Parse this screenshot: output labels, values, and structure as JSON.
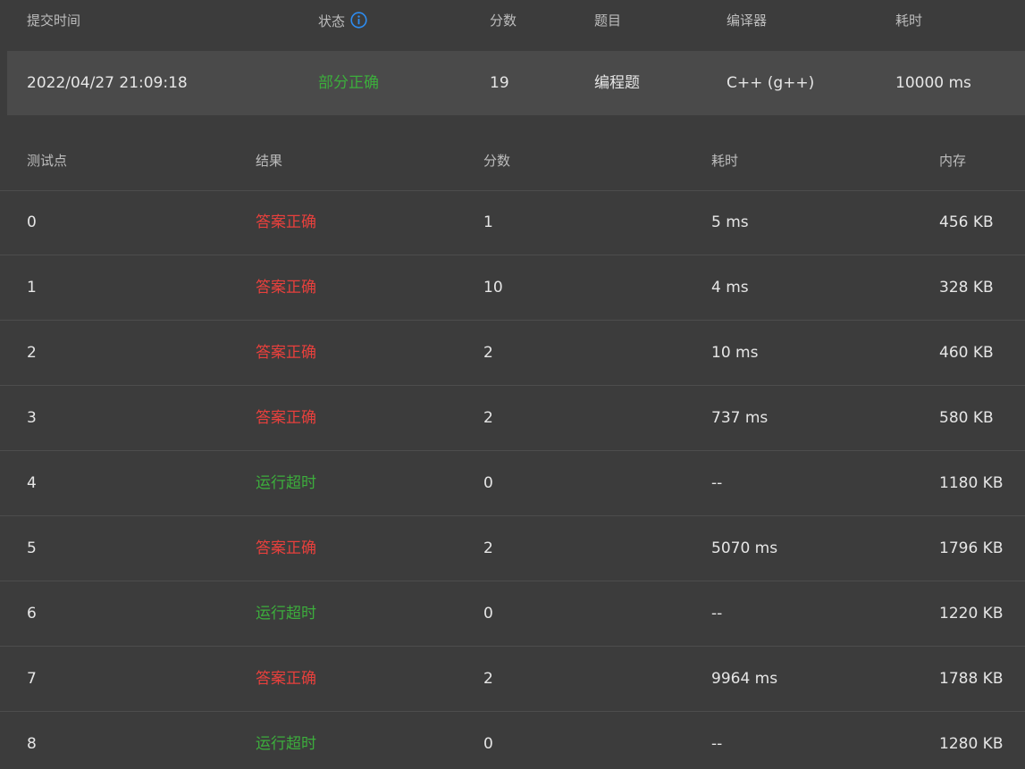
{
  "summary": {
    "headers": {
      "submit_time": "提交时间",
      "status": "状态",
      "score": "分数",
      "problem": "题目",
      "compiler": "编译器",
      "time": "耗时"
    },
    "row": {
      "submit_time": "2022/04/27 21:09:18",
      "status": "部分正确",
      "score": "19",
      "problem": "编程题",
      "compiler": "C++ (g++)",
      "time": "10000 ms"
    },
    "status_color": "#3cae3c",
    "info_icon": "info-circle-icon",
    "info_icon_color": "#2d8cf0"
  },
  "testcases": {
    "headers": {
      "case": "测试点",
      "result": "结果",
      "score": "分数",
      "time": "耗时",
      "memory": "内存"
    },
    "colors": {
      "accepted": "#e8403c",
      "time_limit": "#3cae3c"
    },
    "rows": [
      {
        "case": "0",
        "result": "答案正确",
        "kind": "ac",
        "score": "1",
        "time": "5 ms",
        "memory": "456 KB"
      },
      {
        "case": "1",
        "result": "答案正确",
        "kind": "ac",
        "score": "10",
        "time": "4 ms",
        "memory": "328 KB"
      },
      {
        "case": "2",
        "result": "答案正确",
        "kind": "ac",
        "score": "2",
        "time": "10 ms",
        "memory": "460 KB"
      },
      {
        "case": "3",
        "result": "答案正确",
        "kind": "ac",
        "score": "2",
        "time": "737 ms",
        "memory": "580 KB"
      },
      {
        "case": "4",
        "result": "运行超时",
        "kind": "tle",
        "score": "0",
        "time": "--",
        "memory": "1180 KB"
      },
      {
        "case": "5",
        "result": "答案正确",
        "kind": "ac",
        "score": "2",
        "time": "5070 ms",
        "memory": "1796 KB"
      },
      {
        "case": "6",
        "result": "运行超时",
        "kind": "tle",
        "score": "0",
        "time": "--",
        "memory": "1220 KB"
      },
      {
        "case": "7",
        "result": "答案正确",
        "kind": "ac",
        "score": "2",
        "time": "9964 ms",
        "memory": "1788 KB"
      },
      {
        "case": "8",
        "result": "运行超时",
        "kind": "tle",
        "score": "0",
        "time": "--",
        "memory": "1280 KB"
      }
    ]
  }
}
